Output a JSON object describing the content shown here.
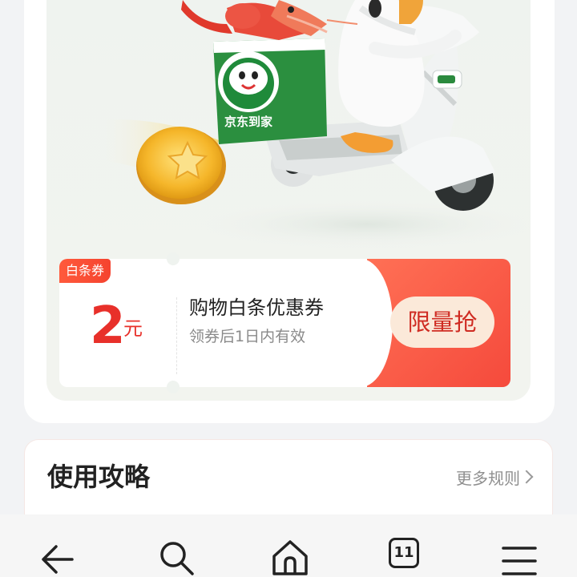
{
  "hero": {
    "box_label": "京东到家"
  },
  "coupon": {
    "tag": "白条券",
    "amount": "2",
    "unit": "元",
    "title": "购物白条优惠券",
    "subtitle": "领券后1日内有效",
    "button_label": "限量抢",
    "accent_color": "#f54a3c",
    "amount_color": "#e8302a"
  },
  "guide": {
    "title": "使用攻略",
    "more_label": "更多规则"
  },
  "bottom_nav": {
    "tab_count": "11",
    "items": [
      "back-icon",
      "search-icon",
      "home-icon",
      "tabs-icon",
      "menu-icon"
    ]
  }
}
